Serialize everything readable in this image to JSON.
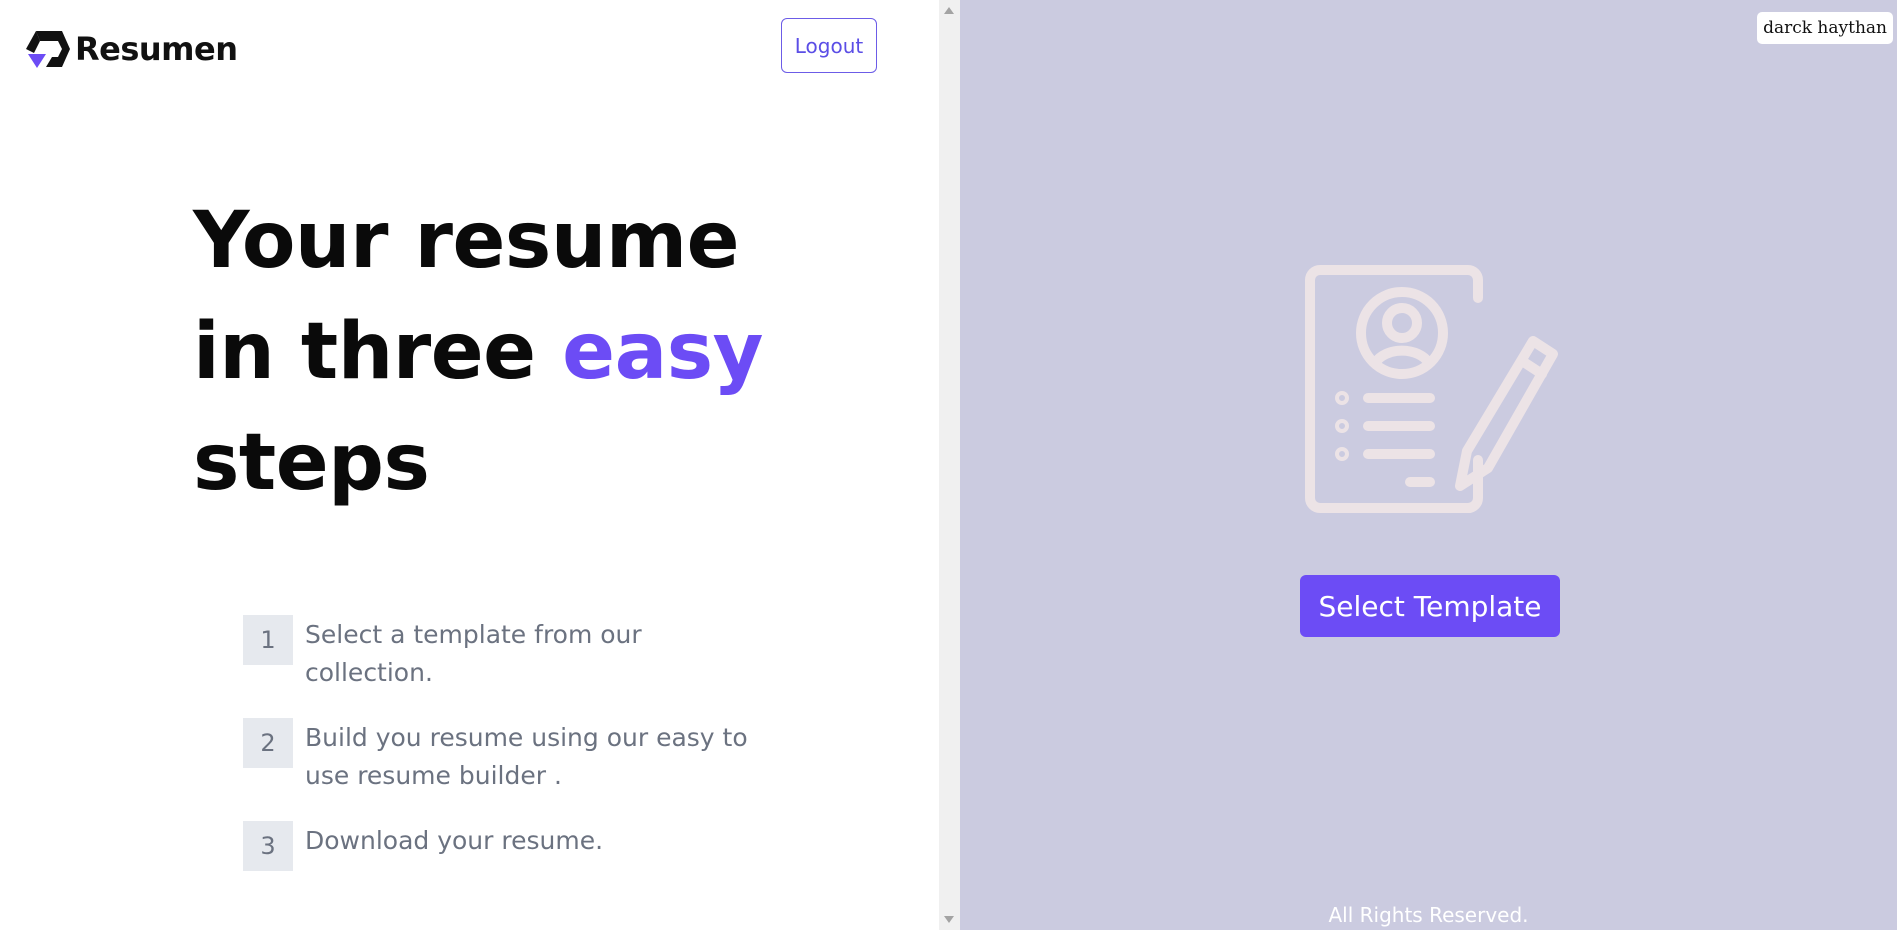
{
  "brand": {
    "name": "Resumen"
  },
  "header": {
    "logout_label": "Logout"
  },
  "hero": {
    "line1": "Your resume",
    "line2_prefix": "in three",
    "line2_accent": "easy",
    "line3": "steps"
  },
  "steps": [
    {
      "number": "1",
      "text": "Select a template from our collection."
    },
    {
      "number": "2",
      "text": "Build you resume using our easy to use resume builder ."
    },
    {
      "number": "3",
      "text": "Download your resume."
    }
  ],
  "user": {
    "name": "darck haythan"
  },
  "panel": {
    "select_template_label": "Select Template",
    "footer": "All Rights Reserved."
  },
  "icons": {
    "logo": "logo-icon",
    "resume": "resume-edit-icon",
    "scroll_up": "chevron-up-icon",
    "scroll_down": "chevron-down-icon"
  },
  "colors": {
    "accent": "#6c4cf5",
    "panel_bg": "#cbcbe0",
    "step_bg": "#e6e9ee",
    "muted_text": "#6b7280"
  }
}
